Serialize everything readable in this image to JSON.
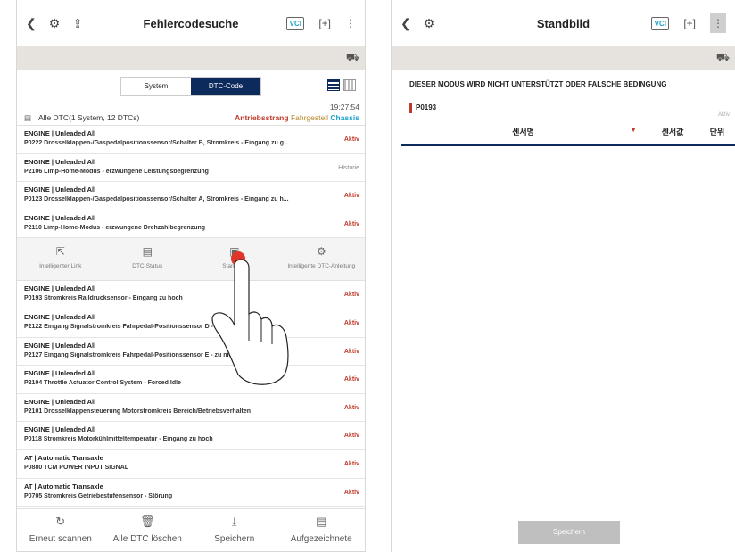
{
  "left": {
    "title": "Fehlercodesuche",
    "vci_label": "VCI",
    "toggle": {
      "system": "System",
      "dtc": "DTC-Code"
    },
    "time": "19:27:54",
    "summary": "Alle DTC(1 System, 12 DTCs)",
    "categories": {
      "a": "Antriebsstrang",
      "f": "Fahrgestell",
      "c": "Chassis"
    },
    "dtcs_top": [
      {
        "sys": "ENGINE | Unleaded All",
        "desc": "P0222 Drosselklappen-/Gaspedalpositionssensor/Schalter B, Stromkreis - Eingang zu g...",
        "status": "Aktiv"
      },
      {
        "sys": "ENGINE | Unleaded All",
        "desc": "P2106 Limp-Home-Modus - erzwungene Leistungsbegrenzung",
        "status": "Historie"
      },
      {
        "sys": "ENGINE | Unleaded All",
        "desc": "P0123 Drosselklappen-/Gaspedalpositionssensor/Schalter A, Stromkreis - Eingang zu h...",
        "status": "Aktiv"
      },
      {
        "sys": "ENGINE | Unleaded All",
        "desc": "P2110 Limp-Home-Modus - erzwungene Drehzahlbegrenzung",
        "status": "Aktiv"
      }
    ],
    "actions": [
      "Intelligenter Link",
      "DTC-Status",
      "Standbild",
      "Intelligente DTC-Anleitung"
    ],
    "dtcs_bottom": [
      {
        "sys": "ENGINE | Unleaded All",
        "desc": "P0193 Stromkreis Raildrucksensor - Eingang zu hoch",
        "status": "Aktiv"
      },
      {
        "sys": "ENGINE | Unleaded All",
        "desc": "P2122 Eingang Signalstromkreis Fahrpedal-Positionssensor D - zu niedrig",
        "status": "Aktiv"
      },
      {
        "sys": "ENGINE | Unleaded All",
        "desc": "P2127 Eingang Signalstromkreis Fahrpedal-Positionssensor E - zu niedrig",
        "status": "Aktiv"
      },
      {
        "sys": "ENGINE | Unleaded All",
        "desc": "P2104 Throttle Actuator Control System - Forced Idle",
        "status": "Aktiv"
      },
      {
        "sys": "ENGINE | Unleaded All",
        "desc": "P2101 Drosselklappensteuerung Motorstromkreis Bereich/Betriebsverhalten",
        "status": "Aktiv"
      },
      {
        "sys": "ENGINE | Unleaded All",
        "desc": "P0118 Stromkreis Motorkühlmitteltemperatur - Eingang zu hoch",
        "status": "Aktiv"
      },
      {
        "sys": "AT | Automatic Transaxle",
        "desc": "P0880 TCM POWER INPUT SIGNAL",
        "status": "Aktiv"
      },
      {
        "sys": "AT | Automatic Transaxle",
        "desc": "P0705 Stromkreis Getriebestufensensor - Störung",
        "status": "Aktiv"
      }
    ],
    "bottom_nav": [
      "Erneut scannen",
      "Alle DTC löschen",
      "Speichern",
      "Aufgezeichnete"
    ]
  },
  "right": {
    "title": "Standbild",
    "vci_label": "VCI",
    "message": "DIESER MODUS WIRD NICHT UNTERSTÜTZT ODER FALSCHE BEDINGUNG",
    "code": "P0193",
    "status": "Aktiv",
    "columns": [
      "센서명",
      "센서값",
      "단위"
    ],
    "save": "Speichern"
  },
  "colors": {
    "accent": "#0d2a5c",
    "active": "#c0392b",
    "chassis": "#1aa1c9"
  }
}
